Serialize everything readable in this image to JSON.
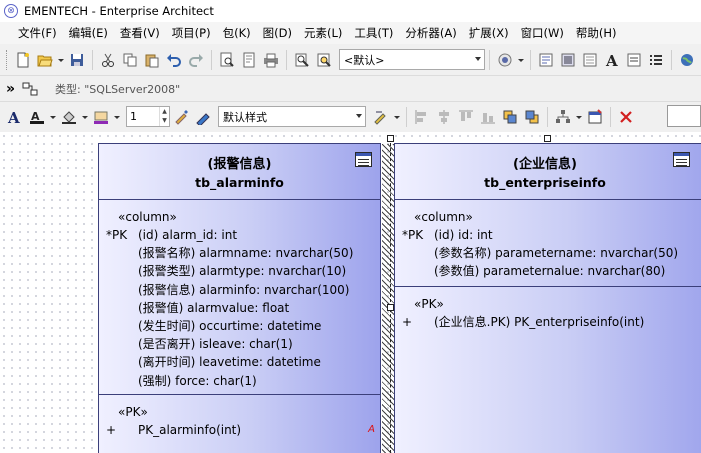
{
  "window": {
    "title": "EMENTECH - Enterprise Architect"
  },
  "menu": [
    "文件(F)",
    "编辑(E)",
    "查看(V)",
    "项目(P)",
    "包(K)",
    "图(D)",
    "元素(L)",
    "工具(T)",
    "分析器(A)",
    "扩展(X)",
    "窗口(W)",
    "帮助(H)"
  ],
  "toolbar": {
    "perspective_value": "<默认>",
    "class_type_label": "类型: \"SQLServer2008\"",
    "line_width_value": "1",
    "style_value": "默认样式",
    "font_icon_letter": "A"
  },
  "entities": [
    {
      "stereotype": "(报警信息)",
      "table_name": "tb_alarminfo",
      "columns_keyword": "«column»",
      "columns": [
        {
          "marker": "*PK",
          "text": "(id) alarm_id: int"
        },
        {
          "marker": "",
          "text": "(报警名称) alarmname: nvarchar(50)"
        },
        {
          "marker": "",
          "text": "(报警类型) alarmtype: nvarchar(10)"
        },
        {
          "marker": "",
          "text": "(报警信息) alarminfo: nvarchar(100)"
        },
        {
          "marker": "",
          "text": "(报警值) alarmvalue: float"
        },
        {
          "marker": "",
          "text": "(发生时间) occurtime: datetime"
        },
        {
          "marker": "",
          "text": "(是否离开) isleave: char(1)"
        },
        {
          "marker": "",
          "text": "(离开时间) leavetime: datetime"
        },
        {
          "marker": "",
          "text": "(强制) force: char(1)"
        }
      ],
      "pk_keyword": "«PK»",
      "pk_rows": [
        {
          "marker": "+",
          "text": "PK_alarminfo(int)"
        }
      ],
      "corner_marker": "A"
    },
    {
      "stereotype": "(企业信息)",
      "table_name": "tb_enterpriseinfo",
      "columns_keyword": "«column»",
      "columns": [
        {
          "marker": "*PK",
          "text": "(id) id: int"
        },
        {
          "marker": "",
          "text": "(参数名称) parametername: nvarchar(50)"
        },
        {
          "marker": "",
          "text": "(参数值) parameternalue: nvarchar(80)"
        }
      ],
      "pk_keyword": "«PK»",
      "pk_rows": [
        {
          "marker": "+",
          "text": "(企业信息.PK) PK_enterpriseinfo(int)"
        }
      ]
    }
  ],
  "colors": {
    "entity_border": "#3b3f7a",
    "entity_gradient_start": "#f0f0ff",
    "entity_gradient_end": "#9da3ec",
    "marker_red": "#d11111"
  }
}
